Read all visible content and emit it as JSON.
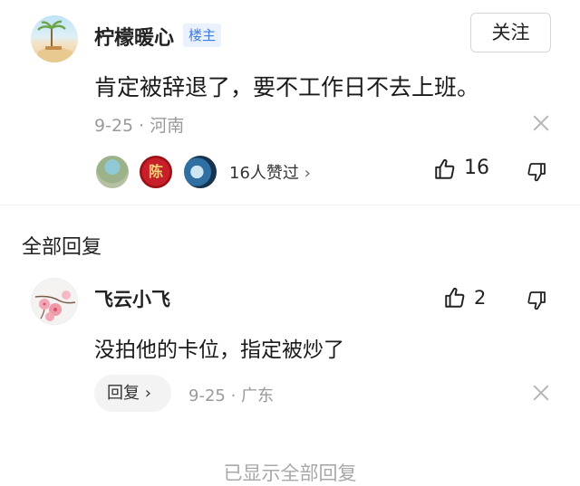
{
  "op": {
    "name": "柠檬暖心",
    "badge": "楼主",
    "follow_label": "关注",
    "text": "肯定被辞退了，要不工作日不去上班。",
    "meta": "9-25 · 河南",
    "avatar_icon": "beach-scene-avatar",
    "likers_text": "16人赞过",
    "likers_chevron": "›",
    "liker2_glyph": "陈",
    "like_count": "16"
  },
  "section_title": "全部回复",
  "reply": {
    "name": "飞云小飞",
    "avatar_icon": "plum-blossom-avatar",
    "like_count": "2",
    "text": "没拍他的卡位，指定被炒了",
    "reply_label": "回复",
    "reply_chevron": "›",
    "meta": "9-25 · 广东"
  },
  "footer_text": "已显示全部回复",
  "colors": {
    "badge_blue": "#3d7ce0",
    "meta_gray": "#9a9a9a"
  }
}
